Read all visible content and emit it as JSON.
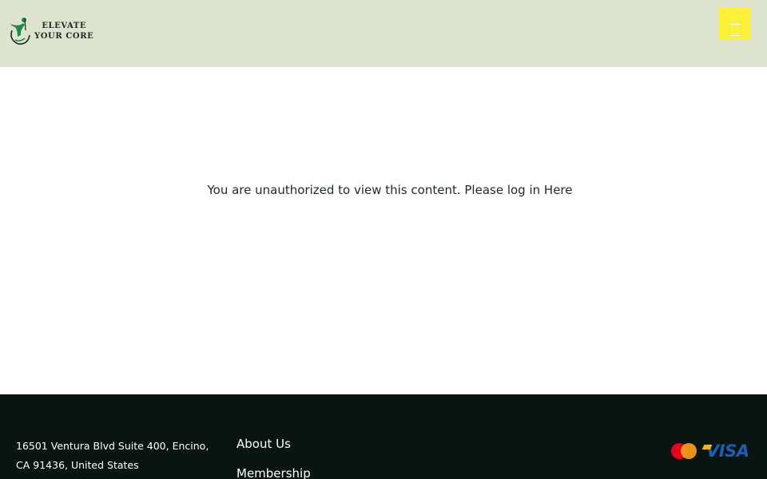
{
  "header": {
    "logo_line1": "ELEVATE",
    "logo_line2": "YOUR CORE",
    "menu_icon": "hamburger-icon",
    "colors": {
      "background": "#dde3cc",
      "menu_button": "#fbf238",
      "logo_green": "#1f8a4c"
    }
  },
  "main": {
    "message": "You are unauthorized to view this content. Please log in",
    "login_link": "Here"
  },
  "footer": {
    "address_line1": "16501 Ventura Blvd Suite 400, Encino,",
    "address_line2": "CA 91436, United States",
    "links": [
      "About Us",
      "Membership"
    ],
    "payments": {
      "mastercard_icon": "mastercard-icon",
      "visa_label": "VISA"
    },
    "colors": {
      "background": "#0a1512"
    }
  }
}
